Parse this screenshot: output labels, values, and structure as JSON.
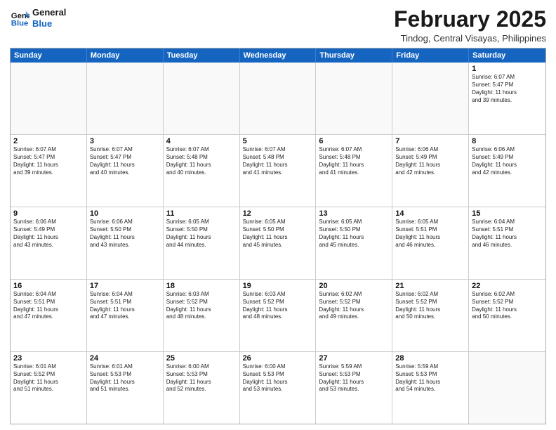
{
  "header": {
    "logo_line1": "General",
    "logo_line2": "Blue",
    "main_title": "February 2025",
    "subtitle": "Tindog, Central Visayas, Philippines"
  },
  "days_of_week": [
    "Sunday",
    "Monday",
    "Tuesday",
    "Wednesday",
    "Thursday",
    "Friday",
    "Saturday"
  ],
  "weeks": [
    [
      {
        "day": "",
        "text": ""
      },
      {
        "day": "",
        "text": ""
      },
      {
        "day": "",
        "text": ""
      },
      {
        "day": "",
        "text": ""
      },
      {
        "day": "",
        "text": ""
      },
      {
        "day": "",
        "text": ""
      },
      {
        "day": "1",
        "text": "Sunrise: 6:07 AM\nSunset: 5:47 PM\nDaylight: 11 hours\nand 39 minutes."
      }
    ],
    [
      {
        "day": "2",
        "text": "Sunrise: 6:07 AM\nSunset: 5:47 PM\nDaylight: 11 hours\nand 39 minutes."
      },
      {
        "day": "3",
        "text": "Sunrise: 6:07 AM\nSunset: 5:47 PM\nDaylight: 11 hours\nand 40 minutes."
      },
      {
        "day": "4",
        "text": "Sunrise: 6:07 AM\nSunset: 5:48 PM\nDaylight: 11 hours\nand 40 minutes."
      },
      {
        "day": "5",
        "text": "Sunrise: 6:07 AM\nSunset: 5:48 PM\nDaylight: 11 hours\nand 41 minutes."
      },
      {
        "day": "6",
        "text": "Sunrise: 6:07 AM\nSunset: 5:48 PM\nDaylight: 11 hours\nand 41 minutes."
      },
      {
        "day": "7",
        "text": "Sunrise: 6:06 AM\nSunset: 5:49 PM\nDaylight: 11 hours\nand 42 minutes."
      },
      {
        "day": "8",
        "text": "Sunrise: 6:06 AM\nSunset: 5:49 PM\nDaylight: 11 hours\nand 42 minutes."
      }
    ],
    [
      {
        "day": "9",
        "text": "Sunrise: 6:06 AM\nSunset: 5:49 PM\nDaylight: 11 hours\nand 43 minutes."
      },
      {
        "day": "10",
        "text": "Sunrise: 6:06 AM\nSunset: 5:50 PM\nDaylight: 11 hours\nand 43 minutes."
      },
      {
        "day": "11",
        "text": "Sunrise: 6:05 AM\nSunset: 5:50 PM\nDaylight: 11 hours\nand 44 minutes."
      },
      {
        "day": "12",
        "text": "Sunrise: 6:05 AM\nSunset: 5:50 PM\nDaylight: 11 hours\nand 45 minutes."
      },
      {
        "day": "13",
        "text": "Sunrise: 6:05 AM\nSunset: 5:50 PM\nDaylight: 11 hours\nand 45 minutes."
      },
      {
        "day": "14",
        "text": "Sunrise: 6:05 AM\nSunset: 5:51 PM\nDaylight: 11 hours\nand 46 minutes."
      },
      {
        "day": "15",
        "text": "Sunrise: 6:04 AM\nSunset: 5:51 PM\nDaylight: 11 hours\nand 46 minutes."
      }
    ],
    [
      {
        "day": "16",
        "text": "Sunrise: 6:04 AM\nSunset: 5:51 PM\nDaylight: 11 hours\nand 47 minutes."
      },
      {
        "day": "17",
        "text": "Sunrise: 6:04 AM\nSunset: 5:51 PM\nDaylight: 11 hours\nand 47 minutes."
      },
      {
        "day": "18",
        "text": "Sunrise: 6:03 AM\nSunset: 5:52 PM\nDaylight: 11 hours\nand 48 minutes."
      },
      {
        "day": "19",
        "text": "Sunrise: 6:03 AM\nSunset: 5:52 PM\nDaylight: 11 hours\nand 48 minutes."
      },
      {
        "day": "20",
        "text": "Sunrise: 6:02 AM\nSunset: 5:52 PM\nDaylight: 11 hours\nand 49 minutes."
      },
      {
        "day": "21",
        "text": "Sunrise: 6:02 AM\nSunset: 5:52 PM\nDaylight: 11 hours\nand 50 minutes."
      },
      {
        "day": "22",
        "text": "Sunrise: 6:02 AM\nSunset: 5:52 PM\nDaylight: 11 hours\nand 50 minutes."
      }
    ],
    [
      {
        "day": "23",
        "text": "Sunrise: 6:01 AM\nSunset: 5:52 PM\nDaylight: 11 hours\nand 51 minutes."
      },
      {
        "day": "24",
        "text": "Sunrise: 6:01 AM\nSunset: 5:53 PM\nDaylight: 11 hours\nand 51 minutes."
      },
      {
        "day": "25",
        "text": "Sunrise: 6:00 AM\nSunset: 5:53 PM\nDaylight: 11 hours\nand 52 minutes."
      },
      {
        "day": "26",
        "text": "Sunrise: 6:00 AM\nSunset: 5:53 PM\nDaylight: 11 hours\nand 53 minutes."
      },
      {
        "day": "27",
        "text": "Sunrise: 5:59 AM\nSunset: 5:53 PM\nDaylight: 11 hours\nand 53 minutes."
      },
      {
        "day": "28",
        "text": "Sunrise: 5:59 AM\nSunset: 5:53 PM\nDaylight: 11 hours\nand 54 minutes."
      },
      {
        "day": "",
        "text": ""
      }
    ]
  ]
}
